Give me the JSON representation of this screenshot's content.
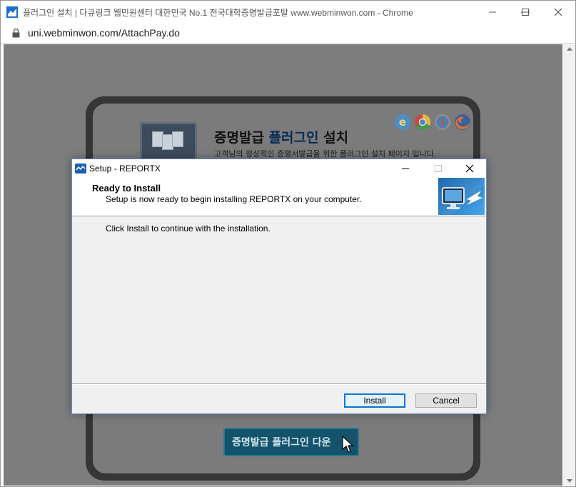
{
  "browser": {
    "title": "플러그인 설치 | 다큐링크 웹민원센터 대한민국 No.1 전국대학증명발급포탈 www.webminwon.com - Chrome",
    "url": "uni.webminwon.com/AttachPay.do",
    "minimize_symbol": "—",
    "restore_symbol": "☐",
    "close_symbol": "✕"
  },
  "page": {
    "heading_prefix": "증명발급",
    "heading_accent": "플러그인",
    "heading_suffix": "설치",
    "description": "고객님의 정상적인 증명서발급을 위한 플러그인 설치 페이지 입니다.",
    "download_button": "증명발급 플러그인 다운"
  },
  "dialog": {
    "title": "Setup - REPORTX",
    "heading": "Ready to Install",
    "subheading": "Setup is now ready to begin installing REPORTX on your computer.",
    "body": "Click Install to continue with the installation.",
    "install_label": "Install",
    "cancel_label": "Cancel",
    "minimize_symbol": "—",
    "maximize_symbol": "☐",
    "close_symbol": "✕"
  },
  "colors": {
    "accent": "#062a57",
    "dialog_border": "#6b8ecf",
    "primary_button_border": "#0078d7",
    "overlay": "#7d7d7d"
  }
}
